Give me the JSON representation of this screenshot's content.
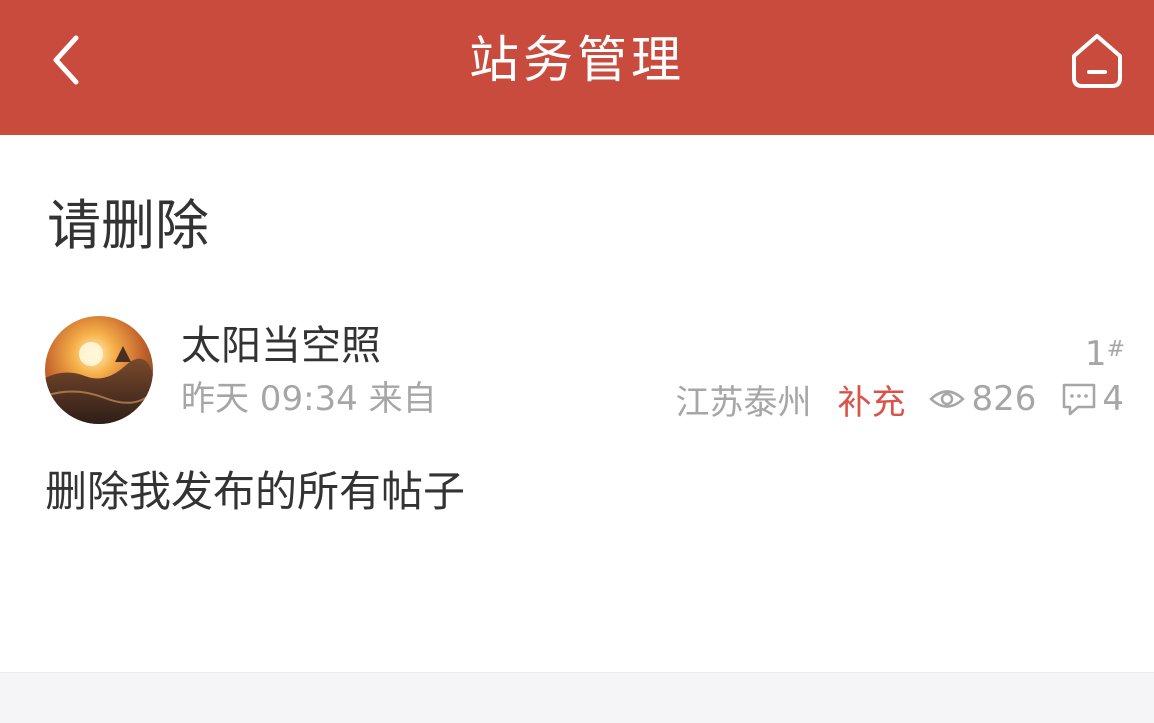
{
  "header": {
    "title": "站务管理",
    "background": "#c94b3d",
    "back_icon": "chevron-left-icon",
    "home_icon": "home-icon"
  },
  "post": {
    "title": "请删除",
    "author": {
      "name": "太阳当空照",
      "avatar_icon": "sunset-avatar"
    },
    "time": "昨天 09:34",
    "source_label": "来自",
    "location": "江苏泰州",
    "supplement_label": "补充",
    "views": "826",
    "comments": "4",
    "floor": "1",
    "floor_mark": "#",
    "body": "删除我发布的所有帖子",
    "accent_color": "#d9534a"
  }
}
